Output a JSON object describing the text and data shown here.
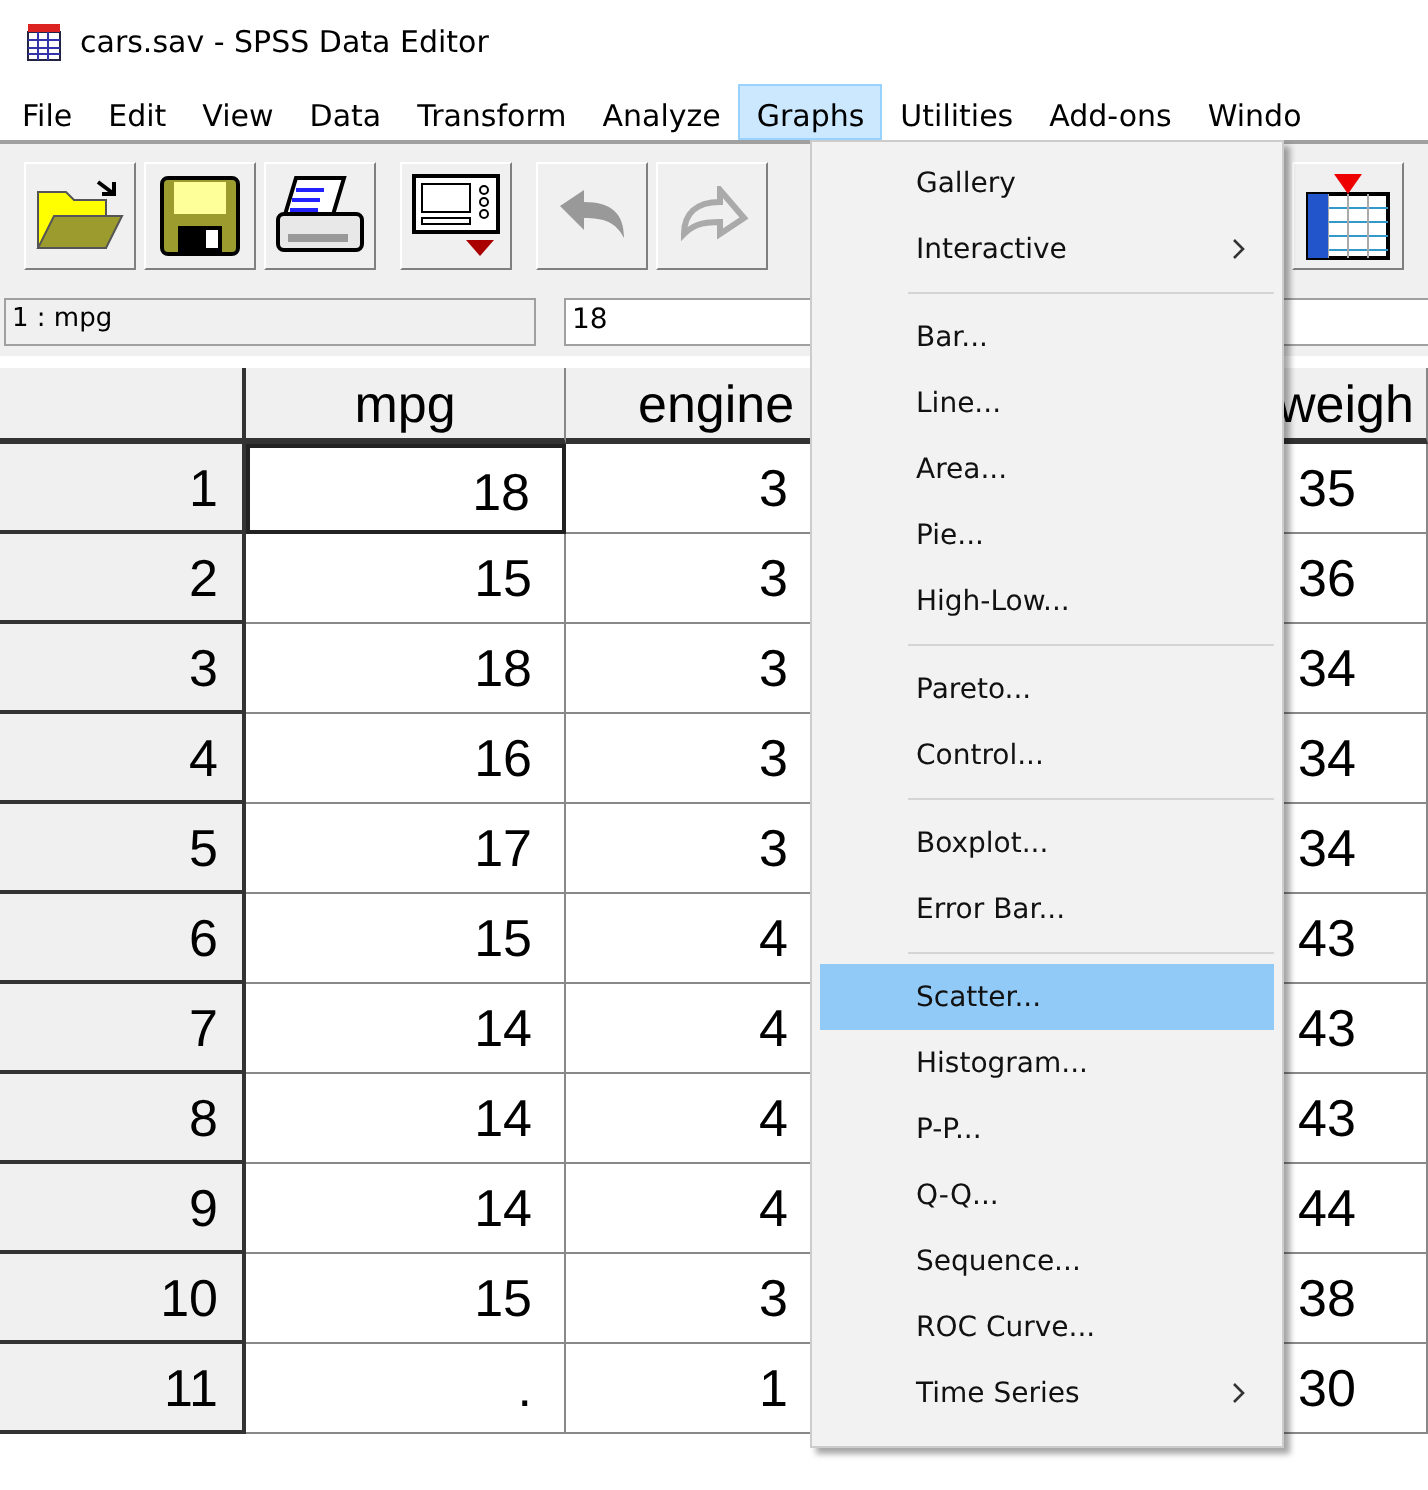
{
  "window": {
    "title": "cars.sav - SPSS Data Editor"
  },
  "menu_bar": [
    {
      "label": "File",
      "selected": false
    },
    {
      "label": "Edit",
      "selected": false
    },
    {
      "label": "View",
      "selected": false
    },
    {
      "label": "Data",
      "selected": false
    },
    {
      "label": "Transform",
      "selected": false
    },
    {
      "label": "Analyze",
      "selected": false
    },
    {
      "label": "Graphs",
      "selected": true
    },
    {
      "label": "Utilities",
      "selected": false
    },
    {
      "label": "Add-ons",
      "selected": false
    },
    {
      "label": "Windo",
      "selected": false
    }
  ],
  "cell_reference": "1 : mpg",
  "cell_value": "18",
  "grid": {
    "columns": [
      {
        "label": "mpg"
      },
      {
        "label": "engine"
      },
      {
        "label": "weigh"
      }
    ],
    "rows": [
      {
        "number": "1",
        "cells": [
          {
            "value": "18",
            "selected": true
          },
          {
            "value": "3",
            "selected": false
          },
          {
            "value": "35",
            "selected": false
          }
        ]
      },
      {
        "number": "2",
        "cells": [
          {
            "value": "15",
            "selected": false
          },
          {
            "value": "3",
            "selected": false
          },
          {
            "value": "36",
            "selected": false
          }
        ]
      },
      {
        "number": "3",
        "cells": [
          {
            "value": "18",
            "selected": false
          },
          {
            "value": "3",
            "selected": false
          },
          {
            "value": "34",
            "selected": false
          }
        ]
      },
      {
        "number": "4",
        "cells": [
          {
            "value": "16",
            "selected": false
          },
          {
            "value": "3",
            "selected": false
          },
          {
            "value": "34",
            "selected": false
          }
        ]
      },
      {
        "number": "5",
        "cells": [
          {
            "value": "17",
            "selected": false
          },
          {
            "value": "3",
            "selected": false
          },
          {
            "value": "34",
            "selected": false
          }
        ]
      },
      {
        "number": "6",
        "cells": [
          {
            "value": "15",
            "selected": false
          },
          {
            "value": "4",
            "selected": false
          },
          {
            "value": "43",
            "selected": false
          }
        ]
      },
      {
        "number": "7",
        "cells": [
          {
            "value": "14",
            "selected": false
          },
          {
            "value": "4",
            "selected": false
          },
          {
            "value": "43",
            "selected": false
          }
        ]
      },
      {
        "number": "8",
        "cells": [
          {
            "value": "14",
            "selected": false
          },
          {
            "value": "4",
            "selected": false
          },
          {
            "value": "43",
            "selected": false
          }
        ]
      },
      {
        "number": "9",
        "cells": [
          {
            "value": "14",
            "selected": false
          },
          {
            "value": "4",
            "selected": false
          },
          {
            "value": "44",
            "selected": false
          }
        ]
      },
      {
        "number": "10",
        "cells": [
          {
            "value": "15",
            "selected": false
          },
          {
            "value": "3",
            "selected": false
          },
          {
            "value": "38",
            "selected": false
          }
        ]
      },
      {
        "number": "11",
        "cells": [
          {
            "value": ".",
            "selected": false
          },
          {
            "value": "1",
            "selected": false
          },
          {
            "value": "30",
            "selected": false
          }
        ]
      }
    ]
  },
  "graphs_menu": {
    "items": [
      {
        "kind": "item",
        "label": "Gallery",
        "selected": false,
        "submenu": false
      },
      {
        "kind": "item",
        "label": "Interactive",
        "selected": false,
        "submenu": true
      },
      {
        "kind": "separator"
      },
      {
        "kind": "item",
        "label": "Bar...",
        "selected": false,
        "submenu": false
      },
      {
        "kind": "item",
        "label": "Line...",
        "selected": false,
        "submenu": false
      },
      {
        "kind": "item",
        "label": "Area...",
        "selected": false,
        "submenu": false
      },
      {
        "kind": "item",
        "label": "Pie...",
        "selected": false,
        "submenu": false
      },
      {
        "kind": "item",
        "label": "High-Low...",
        "selected": false,
        "submenu": false
      },
      {
        "kind": "separator"
      },
      {
        "kind": "item",
        "label": "Pareto...",
        "selected": false,
        "submenu": false
      },
      {
        "kind": "item",
        "label": "Control...",
        "selected": false,
        "submenu": false
      },
      {
        "kind": "separator"
      },
      {
        "kind": "item",
        "label": "Boxplot...",
        "selected": false,
        "submenu": false
      },
      {
        "kind": "item",
        "label": "Error Bar...",
        "selected": false,
        "submenu": false
      },
      {
        "kind": "separator"
      },
      {
        "kind": "item",
        "label": "Scatter...",
        "selected": true,
        "submenu": false
      },
      {
        "kind": "item",
        "label": "Histogram...",
        "selected": false,
        "submenu": false
      },
      {
        "kind": "item",
        "label": "P-P...",
        "selected": false,
        "submenu": false
      },
      {
        "kind": "item",
        "label": "Q-Q...",
        "selected": false,
        "submenu": false
      },
      {
        "kind": "item",
        "label": "Sequence...",
        "selected": false,
        "submenu": false
      },
      {
        "kind": "item",
        "label": "ROC Curve...",
        "selected": false,
        "submenu": false
      },
      {
        "kind": "item",
        "label": "Time Series",
        "selected": false,
        "submenu": true
      }
    ]
  }
}
